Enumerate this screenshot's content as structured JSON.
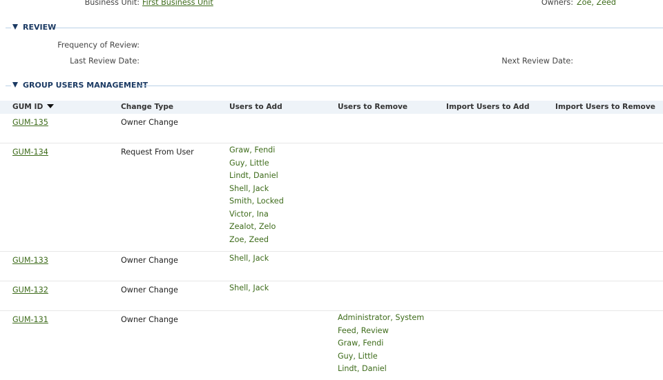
{
  "top": {
    "business_unit_label": "Business Unit:",
    "business_unit_value": "First Business Unit",
    "owners_label": "Owners:",
    "owners_value": "Zoe, Zeed"
  },
  "review": {
    "title": "REVIEW",
    "frequency_label": "Frequency of Review:",
    "last_review_label": "Last Review Date:",
    "next_review_label": "Next Review Date:"
  },
  "gum": {
    "title": "GROUP USERS MANAGEMENT",
    "columns": [
      "GUM ID",
      "Change Type",
      "Users to Add",
      "Users to Remove",
      "Import Users to Add",
      "Import Users to Remove"
    ],
    "rows": [
      {
        "id": "GUM-135",
        "type": "Owner Change",
        "add": [],
        "remove": []
      },
      {
        "id": "GUM-134",
        "type": "Request From User",
        "add": [
          "Graw, Fendi",
          "Guy, Little",
          "Lindt, Daniel",
          "Shell, Jack",
          "Smith, Locked",
          "Victor, Ina",
          "Zealot, Zelo",
          "Zoe, Zeed"
        ],
        "remove": []
      },
      {
        "id": "GUM-133",
        "type": "Owner Change",
        "add": [
          "Shell, Jack"
        ],
        "remove": []
      },
      {
        "id": "GUM-132",
        "type": "Owner Change",
        "add": [
          "Shell, Jack"
        ],
        "remove": []
      },
      {
        "id": "GUM-131",
        "type": "Owner Change",
        "add": [],
        "remove": [
          "Administrator, System",
          "Feed, Review",
          "Graw, Fendi",
          "Guy, Little",
          "Lindt, Daniel"
        ]
      }
    ]
  }
}
